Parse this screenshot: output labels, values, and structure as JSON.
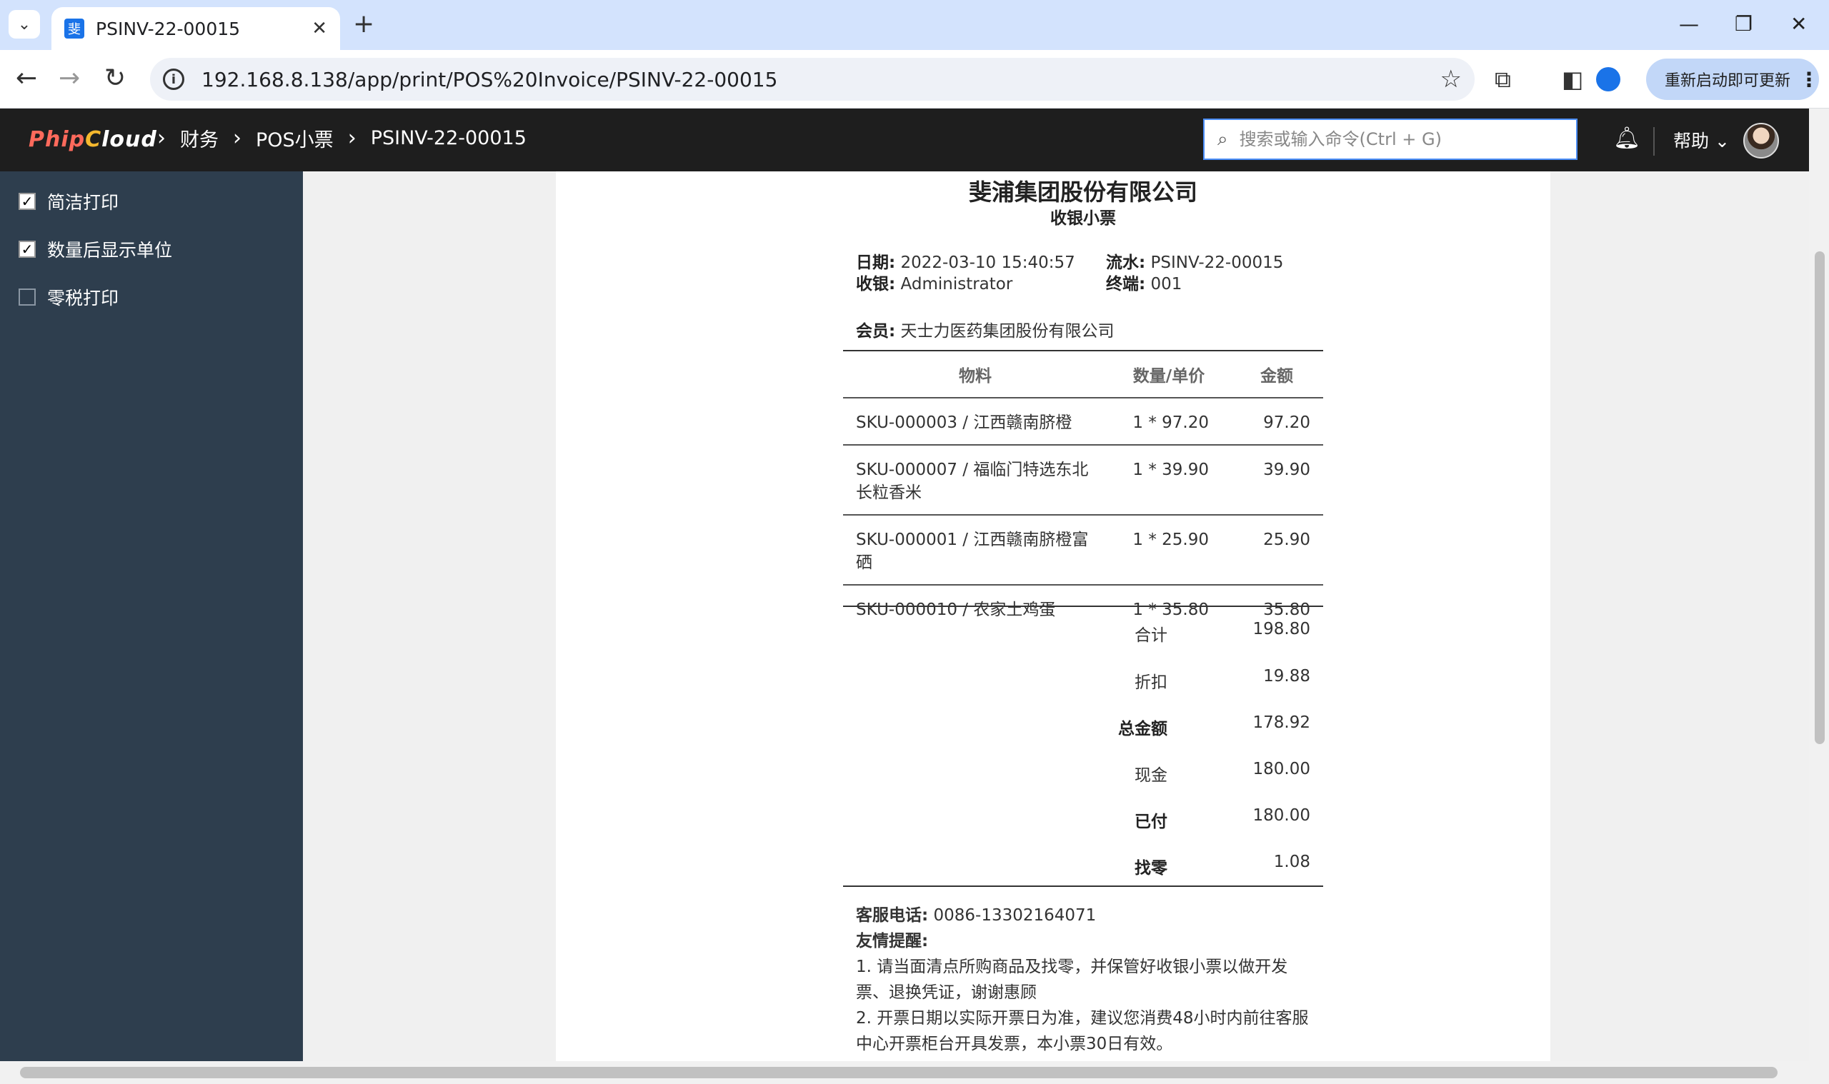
{
  "browser": {
    "tab_title": "PSINV-22-00015",
    "tab_list_icon": "chevron-down-icon",
    "new_tab": "+",
    "url": "192.168.8.138/app/print/POS%20Invoice/PSINV-22-00015",
    "update_label": "重新启动即可更新",
    "update_menu": "⋮",
    "win_minimize": "—",
    "win_restore": "❐",
    "win_close": "✕",
    "tab_close": "✕",
    "back": "←",
    "forward": "→",
    "reload": "↻",
    "star": "☆",
    "info": "i"
  },
  "app": {
    "logo_part1": "Phip",
    "logo_part2": "C",
    "logo_part3": "loud",
    "breadcrumb": [
      "财务",
      "POS小票",
      "PSINV-22-00015"
    ],
    "breadcrumb_sep": "›",
    "search_placeholder": "搜索或输入命令(Ctrl + G)",
    "help_label": "帮助",
    "help_caret": "⌄"
  },
  "sidebar": {
    "options": [
      {
        "label": "简洁打印",
        "checked": true
      },
      {
        "label": "数量后显示单位",
        "checked": true
      },
      {
        "label": "零税打印",
        "checked": false
      }
    ],
    "check_mark": "✓"
  },
  "receipt": {
    "company": "斐浦集团股份有限公司",
    "title": "收银小票",
    "date_label": "日期:",
    "date_value": " 2022-03-10 15:40:57",
    "cashier_label": "收银:",
    "cashier_value": " Administrator",
    "serial_label": "流水:",
    "serial_value": " PSINV-22-00015",
    "terminal_label": "终端:",
    "terminal_value": " 001",
    "member_label": "会员:",
    "member_value": " 天士力医药集团股份有限公司",
    "headers": {
      "item": "物料",
      "qty": "数量/单价",
      "amount": "金额"
    },
    "items": [
      {
        "item": "SKU-000003 / 江西赣南脐橙",
        "qty": "1 * 97.20",
        "amount": "97.20"
      },
      {
        "item": "SKU-000007 / 福临门特选东北长粒香米",
        "qty": "1 * 39.90",
        "amount": "39.90"
      },
      {
        "item": "SKU-000001 / 江西赣南脐橙富硒",
        "qty": "1 * 25.90",
        "amount": "25.90"
      },
      {
        "item": "SKU-000010 / 农家土鸡蛋",
        "qty": "1 * 35.80",
        "amount": "35.80"
      }
    ],
    "totals": [
      {
        "label": "合计",
        "value": "198.80",
        "bold": false
      },
      {
        "label": "折扣",
        "value": "19.88",
        "bold": false
      },
      {
        "label": "总金额",
        "value": "178.92",
        "bold": true
      },
      {
        "label": "现金",
        "value": "180.00",
        "bold": false
      },
      {
        "label": "已付",
        "value": "180.00",
        "bold": true
      },
      {
        "label": "找零",
        "value": "1.08",
        "bold": true
      }
    ],
    "phone_label": "客服电话:",
    "phone_value": "  0086-13302164071",
    "notes_label": "友情提醒:",
    "note1": "1. 请当面清点所购商品及找零，并保管好收银小票以做开发票、退换凭证，谢谢惠顾",
    "note2": "2. 开票日期以实际开票日为准，建议您消费48小时内前往客服中心开票柜台开具发票，本小票30日有效。"
  }
}
